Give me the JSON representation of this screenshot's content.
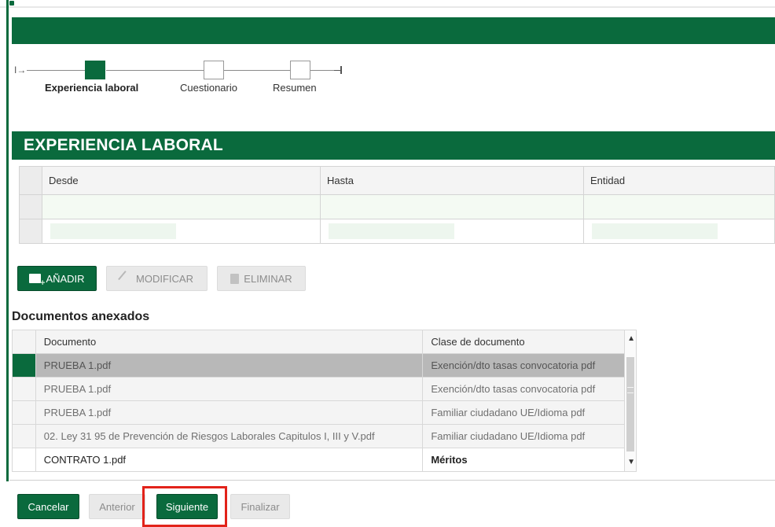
{
  "stepper": {
    "start_glyph": "I→",
    "steps": [
      {
        "label": "Experiencia laboral",
        "active": true
      },
      {
        "label": "Cuestionario",
        "active": false
      },
      {
        "label": "Resumen",
        "active": false
      }
    ]
  },
  "section": {
    "title": "EXPERIENCIA LABORAL",
    "table": {
      "columns": [
        "Desde",
        "Hasta",
        "Entidad"
      ],
      "rows": [
        [
          "",
          "",
          ""
        ],
        [
          "",
          "",
          ""
        ]
      ]
    },
    "actions": {
      "add_label": "AÑADIR",
      "modify_label": "MODIFICAR",
      "delete_label": "ELIMINAR"
    }
  },
  "documents": {
    "title": "Documentos anexados",
    "columns": [
      "Documento",
      "Clase de documento"
    ],
    "rows": [
      {
        "documento": "PRUEBA 1.pdf",
        "clase": "Exención/dto tasas convocatoria pdf"
      },
      {
        "documento": "PRUEBA 1.pdf",
        "clase": "Exención/dto tasas convocatoria pdf"
      },
      {
        "documento": "PRUEBA 1.pdf",
        "clase": "Familiar ciudadano UE/Idioma pdf"
      },
      {
        "documento": "02. Ley 31 95 de Prevención de Riesgos Laborales Capitulos I, III y V.pdf",
        "clase": "Familiar ciudadano UE/Idioma pdf"
      },
      {
        "documento": "CONTRATO 1.pdf",
        "clase": "Méritos"
      }
    ]
  },
  "footer": {
    "cancel_label": "Cancelar",
    "previous_label": "Anterior",
    "next_label": "Siguiente",
    "finish_label": "Finalizar"
  },
  "colors": {
    "brand_green": "#0a6a3d",
    "highlight_red": "#e2231a"
  }
}
